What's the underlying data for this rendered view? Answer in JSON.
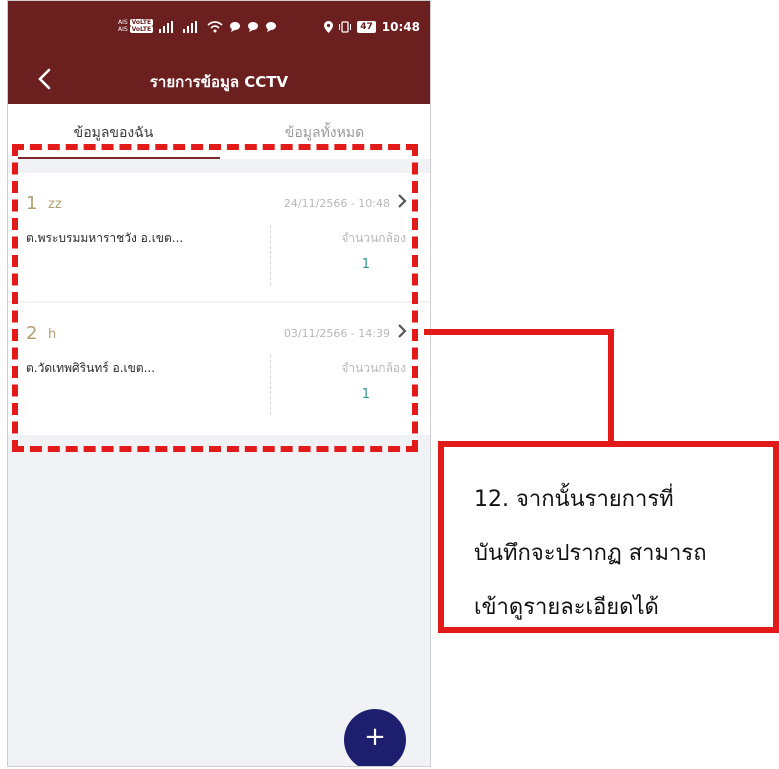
{
  "status_bar": {
    "carrier_top": "AIS",
    "carrier_bottom": "AIS",
    "volte_label": "VoLTE",
    "battery": "47",
    "time": "10:48"
  },
  "app_bar": {
    "title": "รายการข้อมูล CCTV"
  },
  "tabs": [
    {
      "label": "ข้อมูลของฉัน",
      "active": true
    },
    {
      "label": "ข้อมูลทั้งหมด",
      "active": false
    }
  ],
  "records": [
    {
      "number": "1",
      "name": "zz",
      "datetime": "24/11/2566 - 10:48",
      "location": "ต.พระบรมมหาราชวัง อ.เขต...",
      "camera_label": "จำนวนกล้อง",
      "camera_count": "1"
    },
    {
      "number": "2",
      "name": "h",
      "datetime": "03/11/2566 - 14:39",
      "location": "ต.วัดเทพศิรินทร์ อ.เขต...",
      "camera_label": "จำนวนกล้อง",
      "camera_count": "1"
    }
  ],
  "fab": {
    "label": "+"
  },
  "callout": {
    "line1": "12. จากนั้นรายการที่",
    "line2": "บันทึกจะปรากฏ สามารถ",
    "line3": "เข้าดูรายละเอียดได้"
  },
  "colors": {
    "header": "#6b1f1f",
    "accent_red": "#e31a1a",
    "fab": "#1e1e6e",
    "count_teal": "#2e9a8a"
  }
}
